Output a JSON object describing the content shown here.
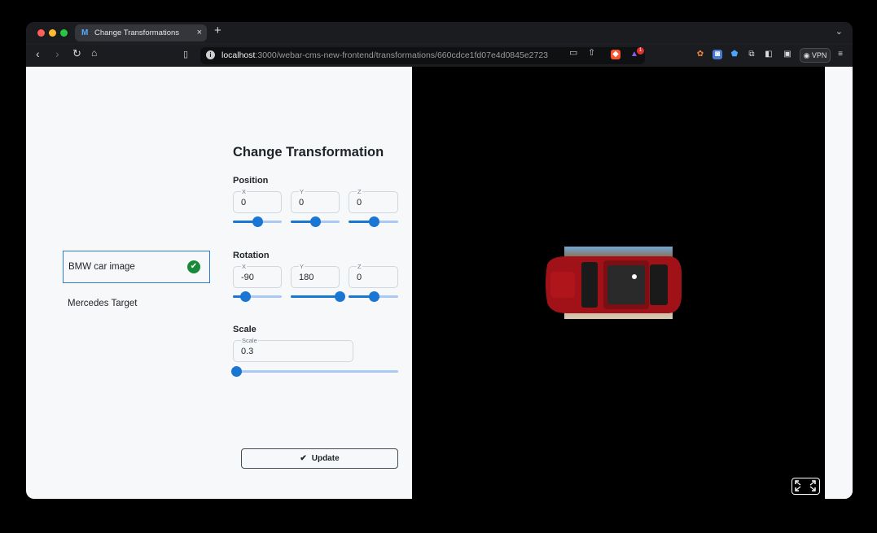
{
  "browser": {
    "tab_title": "Change Transformations",
    "tab_favicon": "M",
    "tab_close": "×",
    "new_tab": "+",
    "url_host": "localhost",
    "url_rest": ":3000/webar-cms-new-frontend/transformations/660cdce1fd07e4d0845e2723",
    "vpn_label": "VPN",
    "notification_count": "1"
  },
  "targets": [
    {
      "label": "BMW car image",
      "selected": true
    },
    {
      "label": "Mercedes Target",
      "selected": false
    }
  ],
  "form": {
    "title": "Change Transformation",
    "position": {
      "label": "Position",
      "x": {
        "label": "X",
        "value": "0",
        "slider": 0.5
      },
      "y": {
        "label": "Y",
        "value": "0",
        "slider": 0.5
      },
      "z": {
        "label": "Z",
        "value": "0",
        "slider": 0.5
      }
    },
    "rotation": {
      "label": "Rotation",
      "x": {
        "label": "X",
        "value": "-90",
        "slider": 0.25
      },
      "y": {
        "label": "Y",
        "value": "180",
        "slider": 1.0
      },
      "z": {
        "label": "Z",
        "value": "0",
        "slider": 0.5
      }
    },
    "scale": {
      "label": "Scale",
      "field_label": "Scale",
      "value": "0.3",
      "slider": 0.0
    },
    "update_label": "Update"
  },
  "colors": {
    "accent": "#1976d2",
    "success": "#1a8a3a",
    "car": "#a01218"
  }
}
